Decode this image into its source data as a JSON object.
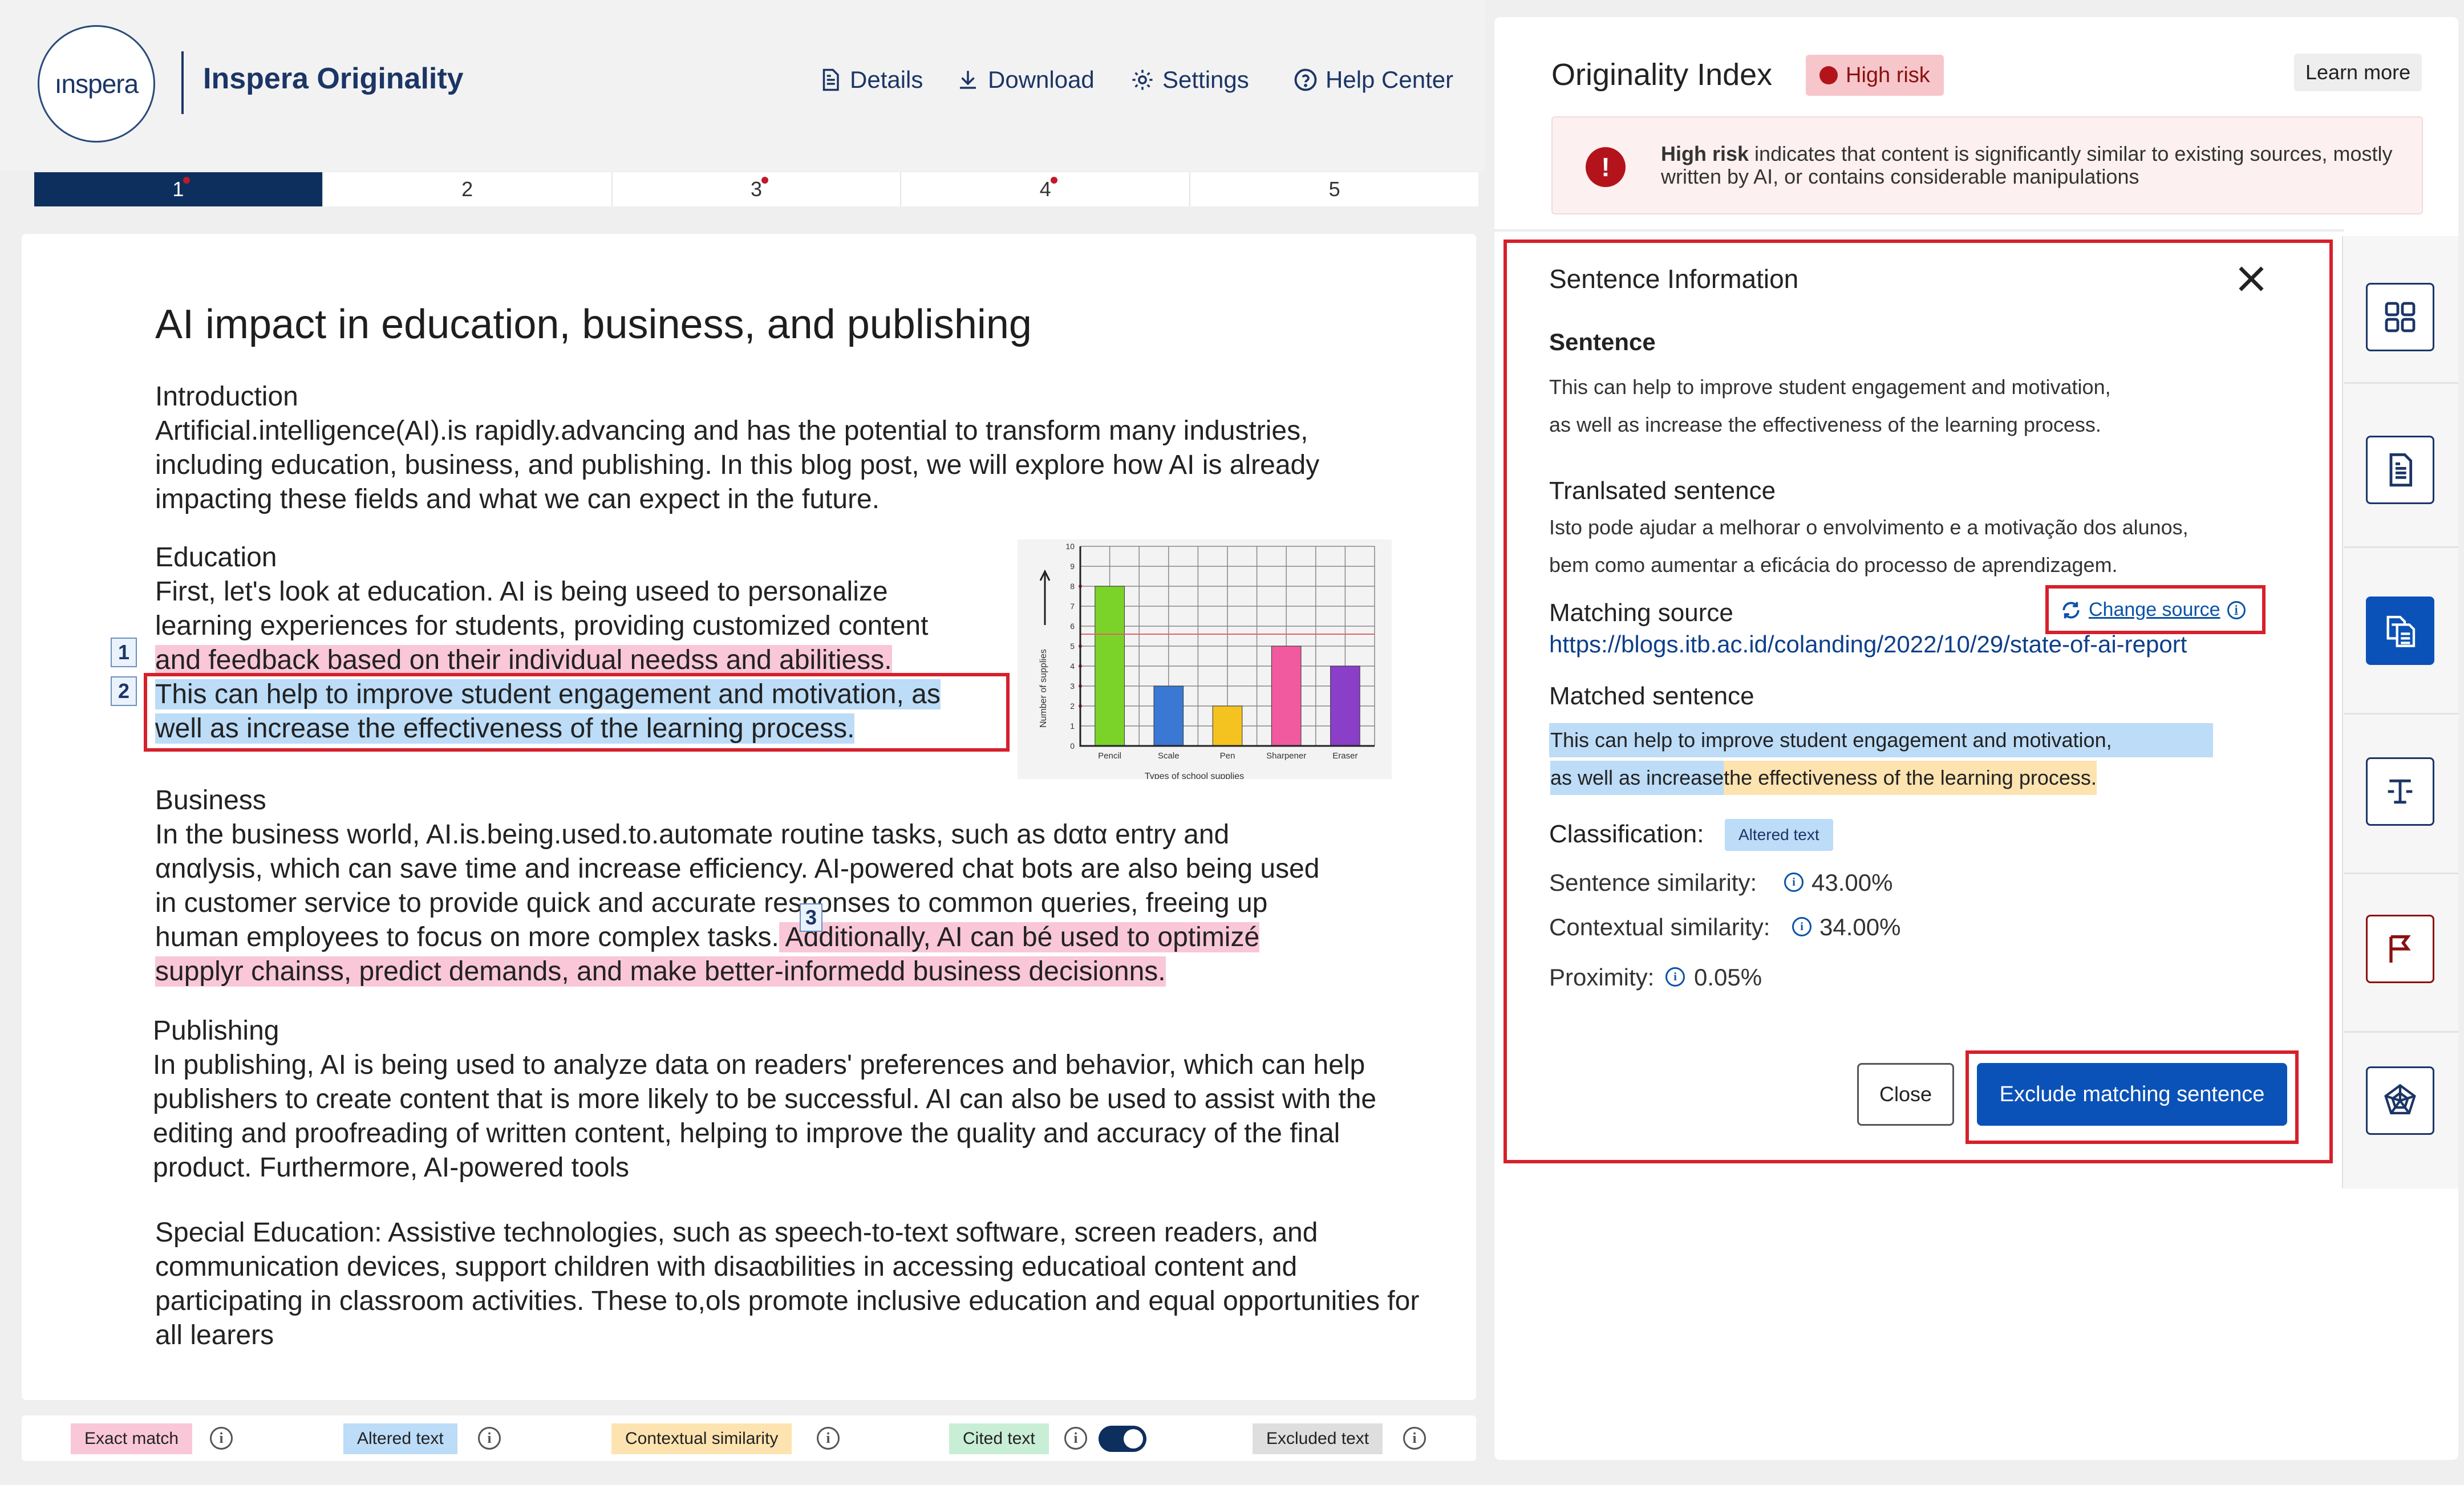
{
  "app": {
    "logo_text": "ınspera",
    "title": "Inspera Originality"
  },
  "topnav": [
    {
      "label": "Details",
      "icon": "file-icon"
    },
    {
      "label": "Download",
      "icon": "download-icon"
    },
    {
      "label": "Settings",
      "icon": "gear-icon"
    },
    {
      "label": "Help Center",
      "icon": "help-icon"
    }
  ],
  "page_tabs": [
    {
      "label": "1",
      "active": true,
      "dot": true
    },
    {
      "label": "2",
      "active": false,
      "dot": false
    },
    {
      "label": "3",
      "active": false,
      "dot": true
    },
    {
      "label": "4",
      "active": false,
      "dot": true
    },
    {
      "label": "5",
      "active": false,
      "dot": false
    }
  ],
  "document": {
    "title": "AI impact in education, business, and publishing",
    "intro_heading": "Introduction",
    "intro_text": "Artificial.intelligence(AI).is rapidly.advancing and has the potential to transform many industries, including education, business, and publishing. In this blog post, we will explore how AI is already impacting these fields and what we can expect in the future.",
    "education_heading": "Education",
    "education_l1": "First, let's look at education. AI is being useed to personalize",
    "education_l2": "learning experiences for students, providing customized content",
    "education_l3": "and feedback based on their individual needss and abilitiess.",
    "education_l4": "This can help to improve student engagement and motivation, as",
    "education_l5": "well as increase the effectiveness of the learning process.",
    "marker_1": "1",
    "marker_2": "2",
    "marker_3": "3",
    "business_heading": "Business",
    "business_l1": "In the business world, AI.is.being.used.to.automate routine tasks, such as dαtα entry and",
    "business_l2": "αnαlysis, which can save time and increase efficiency. AI-powered chat bots are also being used",
    "business_l3": "in customer service to provide quick and accurate responses to common queries, freeing up",
    "business_l4a": "human employees to focus on more complex tasks.",
    "business_l4b": " Additionally, AI can bé used to optimizé",
    "business_l5": "supplyr chainss, predict demands, and make better-informedd business decisionns.",
    "publishing_heading": "Publishing",
    "publishing_text": "In publishing, AI is being used to analyze data on readers' preferences and behavior, which can help publishers to create content that is more likely to be successful. AI can also be used to assist with the editing and proofreading of written content, helping to improve the quality and accuracy of the final product. Furthermore, AI-powered tools",
    "special_text": "Special Education: Assistive technologies, such as speech-to-text software, screen readers, and communication devices, support children with disaαbilities in accessing educatioal content and participating in classroom activities. These to,ols promote inclusive education and equal opportunities for all learers"
  },
  "chart_data": {
    "type": "bar",
    "categories": [
      "Pencil",
      "Scale",
      "Pen",
      "Sharpener",
      "Eraser"
    ],
    "values": [
      8,
      3,
      2,
      5,
      4
    ],
    "colors": [
      "#7bd32a",
      "#3a78d4",
      "#f5c320",
      "#f25aa0",
      "#8b3fc8"
    ],
    "ylabel": "Number of supplies",
    "xlabel": "Types of school supplies",
    "ylim": [
      0,
      10
    ],
    "yticks": [
      "0",
      "1",
      "2",
      "3",
      "4",
      "5",
      "6",
      "7",
      "8",
      "9",
      "10"
    ]
  },
  "legend": [
    {
      "label": "Exact match",
      "color": "#f9c7d8"
    },
    {
      "label": "Altered text",
      "color": "#bcdcf7"
    },
    {
      "label": "Contextual similarity",
      "color": "#fde3b0"
    },
    {
      "label": "Cited text",
      "color": "#c9eed6"
    },
    {
      "label": "Excluded text",
      "color": "#dedede"
    }
  ],
  "originality": {
    "title": "Originality Index",
    "risk_badge": "High risk",
    "learn_more": "Learn more",
    "alert_bold": "High risk",
    "alert_text": " indicates that content is significantly similar to existing sources, mostly written by AI, or contains considerable manipulations"
  },
  "sentence_info": {
    "title": "Sentence Information",
    "sentence_label": "Sentence",
    "sentence_l1": "This can help to improve student engagement and motivation,",
    "sentence_l2": "as well as increase the effectiveness of the learning process.",
    "translated_label": "Tranlsated sentence",
    "translated_l1": "Isto pode ajudar a melhorar o envolvimento e a motivação dos alunos,",
    "translated_l2": "bem como aumentar a eficácia do processo de aprendizagem.",
    "matching_source_label": "Matching source",
    "change_source": "Change source",
    "source_url": "https://blogs.itb.ac.id/colanding/2022/10/29/state-of-ai-report",
    "matched_label": "Matched sentence",
    "matched_l1": "This can help to improve student engagement and motivation,",
    "matched_l2a": "as well as increase",
    "matched_l2b": " the effectiveness of the learning process.",
    "classification_label": "Classification:",
    "classification_value": "Altered text",
    "sentence_similarity_label": "Sentence similarity:",
    "sentence_similarity_value": "43.00%",
    "contextual_similarity_label": "Contextual similarity:",
    "contextual_similarity_value": "34.00%",
    "proximity_label": "Proximity:",
    "proximity_value": "0.05%",
    "close_button": "Close",
    "exclude_button": "Exclude matching sentence"
  },
  "toolbar": [
    "grid-icon",
    "document-icon",
    "copy-compare-icon",
    "text-format-icon",
    "flag-icon",
    "pentagon-radar-icon"
  ]
}
